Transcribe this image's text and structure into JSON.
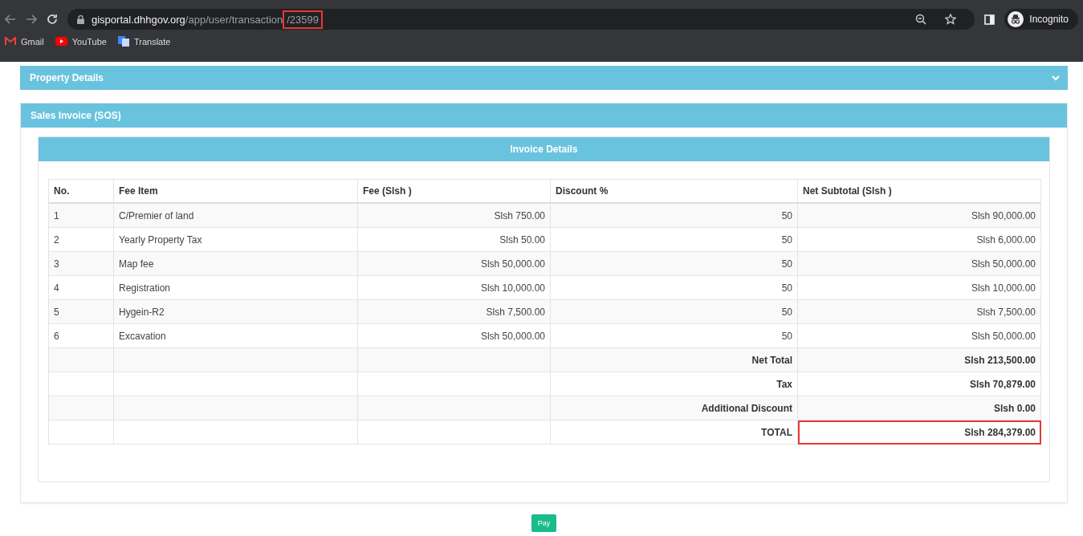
{
  "browser": {
    "url_host": "gisportal.dhhgov.org",
    "url_path": "/app/user/transaction",
    "url_tail": "/23599",
    "url_tail_highlighted": true,
    "profile": "Incognito",
    "bookmarks": [
      {
        "label": "Gmail",
        "kind": "gmail"
      },
      {
        "label": "YouTube",
        "kind": "youtube"
      },
      {
        "label": "Translate",
        "kind": "translate"
      }
    ]
  },
  "panels": [
    {
      "title": "Property Details",
      "expanded": false
    },
    {
      "title": "Sales Invoice (SOS)",
      "expanded": true
    }
  ],
  "invoice": {
    "title": "Invoice Details",
    "columns": [
      "No.",
      "Fee Item",
      "Fee (Slsh )",
      "Discount %",
      "Net Subtotal (Slsh )"
    ],
    "rows": [
      {
        "no": "1",
        "item": "C/Premier of land",
        "fee": "Slsh 750.00",
        "discount": "50",
        "net": "Slsh 90,000.00"
      },
      {
        "no": "2",
        "item": "Yearly Property Tax",
        "fee": "Slsh 50.00",
        "discount": "50",
        "net": "Slsh 6,000.00"
      },
      {
        "no": "3",
        "item": "Map fee",
        "fee": "Slsh 50,000.00",
        "discount": "50",
        "net": "Slsh 50,000.00"
      },
      {
        "no": "4",
        "item": "Registration",
        "fee": "Slsh 10,000.00",
        "discount": "50",
        "net": "Slsh 10,000.00"
      },
      {
        "no": "5",
        "item": "Hygein-R2",
        "fee": "Slsh 7,500.00",
        "discount": "50",
        "net": "Slsh 7,500.00"
      },
      {
        "no": "6",
        "item": "Excavation",
        "fee": "Slsh 50,000.00",
        "discount": "50",
        "net": "Slsh 50,000.00"
      }
    ],
    "summary": [
      {
        "label": "Net Total",
        "value": "Slsh 213,500.00",
        "highlighted": false
      },
      {
        "label": "Tax",
        "value": "Slsh 70,879.00",
        "highlighted": false
      },
      {
        "label": "Additional Discount",
        "value": "Slsh 0.00",
        "highlighted": false
      },
      {
        "label": "TOTAL",
        "value": "Slsh 284,379.00",
        "highlighted": true
      }
    ]
  },
  "pay_button": "Pay"
}
